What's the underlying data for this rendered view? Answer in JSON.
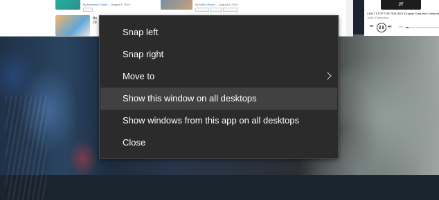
{
  "background": {
    "browser": {
      "byline_prefix_1": "By",
      "byline_author_1": "Mahmoud Omar",
      "byline_date_1": "— August 8, 2019",
      "byline_prefix_2": "By",
      "byline_author_2": "Mike Kirikow",
      "byline_date_2": "— August 8, 2019",
      "partial_title_1": "Be",
      "partial_title_2": "20"
    },
    "media_widget": {
      "album_text": "JT",
      "track_title": "CAN'T STOP THE FEELING! (Original Song from DreamWorks",
      "artist": "Justin Timberlake",
      "time": "0:00",
      "progress": 0.08
    }
  },
  "context_menu": {
    "items": [
      {
        "label": "Snap left",
        "highlighted": false,
        "has_submenu": false
      },
      {
        "label": "Snap right",
        "highlighted": false,
        "has_submenu": false
      },
      {
        "label": "Move to",
        "highlighted": false,
        "has_submenu": true
      },
      {
        "label": "Show this window on all desktops",
        "highlighted": true,
        "has_submenu": false
      },
      {
        "label": "Show windows from this app on all desktops",
        "highlighted": false,
        "has_submenu": false
      },
      {
        "label": "Close",
        "highlighted": false,
        "has_submenu": false
      }
    ],
    "submenu_icon": "chevron-right-icon"
  },
  "colors": {
    "menu_bg": "#2b2b2b",
    "menu_highlight": "#414141",
    "menu_text": "#ffffff"
  }
}
